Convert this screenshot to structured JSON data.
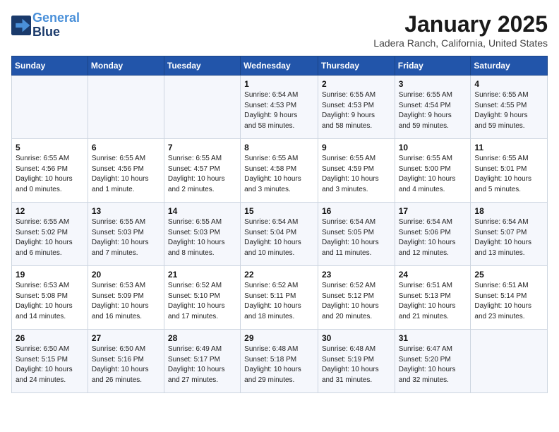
{
  "header": {
    "logo_line1": "General",
    "logo_line2": "Blue",
    "title": "January 2025",
    "subtitle": "Ladera Ranch, California, United States"
  },
  "weekdays": [
    "Sunday",
    "Monday",
    "Tuesday",
    "Wednesday",
    "Thursday",
    "Friday",
    "Saturday"
  ],
  "weeks": [
    [
      {
        "day": "",
        "info": ""
      },
      {
        "day": "",
        "info": ""
      },
      {
        "day": "",
        "info": ""
      },
      {
        "day": "1",
        "info": "Sunrise: 6:54 AM\nSunset: 4:53 PM\nDaylight: 9 hours\nand 58 minutes."
      },
      {
        "day": "2",
        "info": "Sunrise: 6:55 AM\nSunset: 4:53 PM\nDaylight: 9 hours\nand 58 minutes."
      },
      {
        "day": "3",
        "info": "Sunrise: 6:55 AM\nSunset: 4:54 PM\nDaylight: 9 hours\nand 59 minutes."
      },
      {
        "day": "4",
        "info": "Sunrise: 6:55 AM\nSunset: 4:55 PM\nDaylight: 9 hours\nand 59 minutes."
      }
    ],
    [
      {
        "day": "5",
        "info": "Sunrise: 6:55 AM\nSunset: 4:56 PM\nDaylight: 10 hours\nand 0 minutes."
      },
      {
        "day": "6",
        "info": "Sunrise: 6:55 AM\nSunset: 4:56 PM\nDaylight: 10 hours\nand 1 minute."
      },
      {
        "day": "7",
        "info": "Sunrise: 6:55 AM\nSunset: 4:57 PM\nDaylight: 10 hours\nand 2 minutes."
      },
      {
        "day": "8",
        "info": "Sunrise: 6:55 AM\nSunset: 4:58 PM\nDaylight: 10 hours\nand 3 minutes."
      },
      {
        "day": "9",
        "info": "Sunrise: 6:55 AM\nSunset: 4:59 PM\nDaylight: 10 hours\nand 3 minutes."
      },
      {
        "day": "10",
        "info": "Sunrise: 6:55 AM\nSunset: 5:00 PM\nDaylight: 10 hours\nand 4 minutes."
      },
      {
        "day": "11",
        "info": "Sunrise: 6:55 AM\nSunset: 5:01 PM\nDaylight: 10 hours\nand 5 minutes."
      }
    ],
    [
      {
        "day": "12",
        "info": "Sunrise: 6:55 AM\nSunset: 5:02 PM\nDaylight: 10 hours\nand 6 minutes."
      },
      {
        "day": "13",
        "info": "Sunrise: 6:55 AM\nSunset: 5:03 PM\nDaylight: 10 hours\nand 7 minutes."
      },
      {
        "day": "14",
        "info": "Sunrise: 6:55 AM\nSunset: 5:03 PM\nDaylight: 10 hours\nand 8 minutes."
      },
      {
        "day": "15",
        "info": "Sunrise: 6:54 AM\nSunset: 5:04 PM\nDaylight: 10 hours\nand 10 minutes."
      },
      {
        "day": "16",
        "info": "Sunrise: 6:54 AM\nSunset: 5:05 PM\nDaylight: 10 hours\nand 11 minutes."
      },
      {
        "day": "17",
        "info": "Sunrise: 6:54 AM\nSunset: 5:06 PM\nDaylight: 10 hours\nand 12 minutes."
      },
      {
        "day": "18",
        "info": "Sunrise: 6:54 AM\nSunset: 5:07 PM\nDaylight: 10 hours\nand 13 minutes."
      }
    ],
    [
      {
        "day": "19",
        "info": "Sunrise: 6:53 AM\nSunset: 5:08 PM\nDaylight: 10 hours\nand 14 minutes."
      },
      {
        "day": "20",
        "info": "Sunrise: 6:53 AM\nSunset: 5:09 PM\nDaylight: 10 hours\nand 16 minutes."
      },
      {
        "day": "21",
        "info": "Sunrise: 6:52 AM\nSunset: 5:10 PM\nDaylight: 10 hours\nand 17 minutes."
      },
      {
        "day": "22",
        "info": "Sunrise: 6:52 AM\nSunset: 5:11 PM\nDaylight: 10 hours\nand 18 minutes."
      },
      {
        "day": "23",
        "info": "Sunrise: 6:52 AM\nSunset: 5:12 PM\nDaylight: 10 hours\nand 20 minutes."
      },
      {
        "day": "24",
        "info": "Sunrise: 6:51 AM\nSunset: 5:13 PM\nDaylight: 10 hours\nand 21 minutes."
      },
      {
        "day": "25",
        "info": "Sunrise: 6:51 AM\nSunset: 5:14 PM\nDaylight: 10 hours\nand 23 minutes."
      }
    ],
    [
      {
        "day": "26",
        "info": "Sunrise: 6:50 AM\nSunset: 5:15 PM\nDaylight: 10 hours\nand 24 minutes."
      },
      {
        "day": "27",
        "info": "Sunrise: 6:50 AM\nSunset: 5:16 PM\nDaylight: 10 hours\nand 26 minutes."
      },
      {
        "day": "28",
        "info": "Sunrise: 6:49 AM\nSunset: 5:17 PM\nDaylight: 10 hours\nand 27 minutes."
      },
      {
        "day": "29",
        "info": "Sunrise: 6:48 AM\nSunset: 5:18 PM\nDaylight: 10 hours\nand 29 minutes."
      },
      {
        "day": "30",
        "info": "Sunrise: 6:48 AM\nSunset: 5:19 PM\nDaylight: 10 hours\nand 31 minutes."
      },
      {
        "day": "31",
        "info": "Sunrise: 6:47 AM\nSunset: 5:20 PM\nDaylight: 10 hours\nand 32 minutes."
      },
      {
        "day": "",
        "info": ""
      }
    ]
  ]
}
